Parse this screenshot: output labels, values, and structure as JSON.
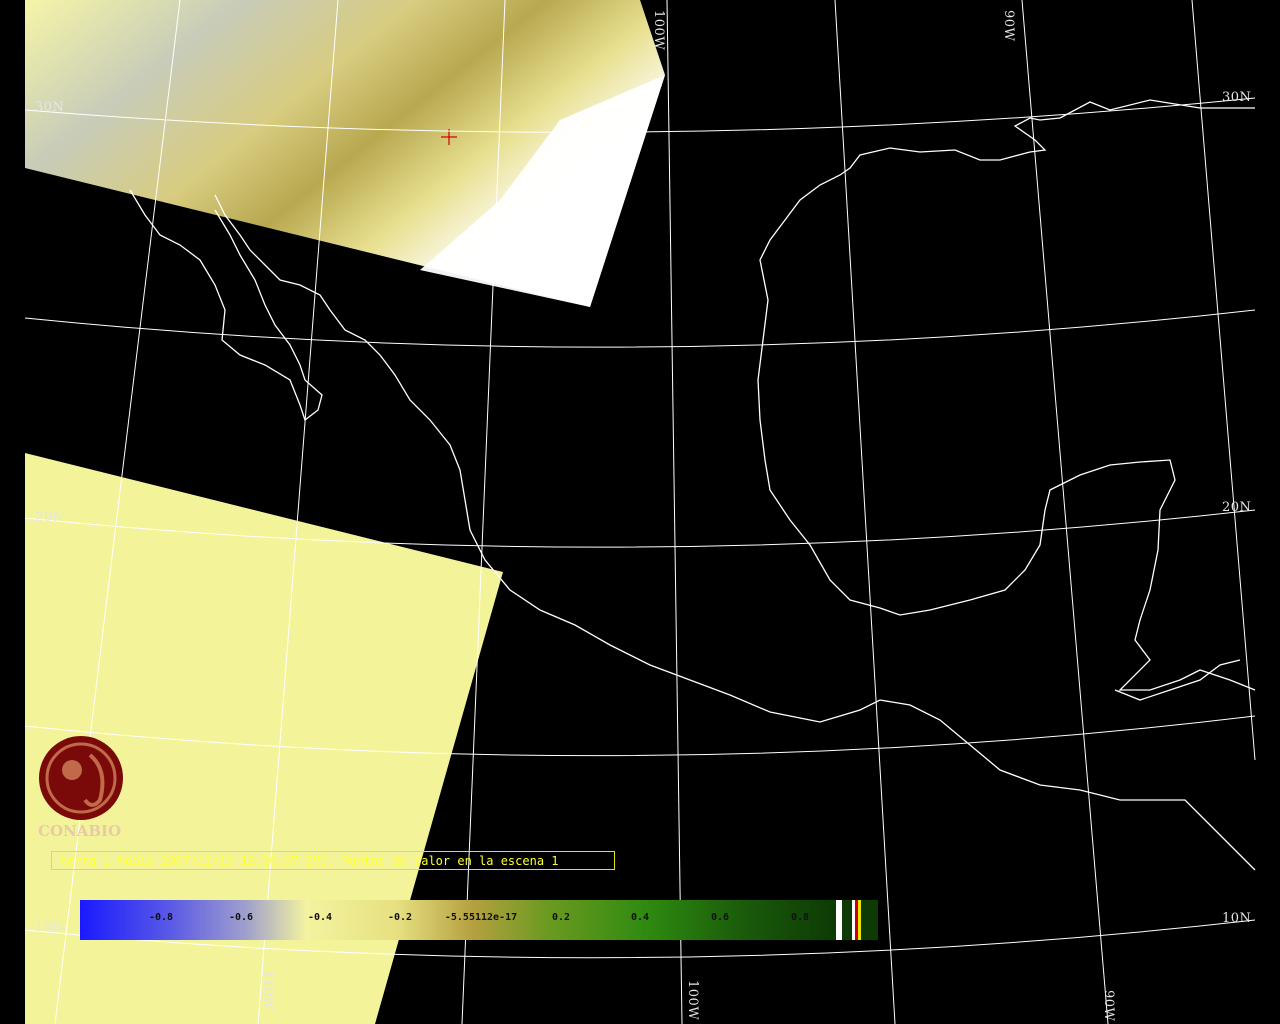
{
  "map": {
    "grid_labels": {
      "lon_100w_top": "100W",
      "lon_90w_top": "90W",
      "lat_30n_left": "30N",
      "lat_30n_right": "30N",
      "lat_20n_left": "20N",
      "lat_20n_right": "20N",
      "lat_10n_left": "10N",
      "lat_10n_right": "10N",
      "lon_100w_bottom": "100W",
      "lon_90w_bottom": "90W",
      "lon_110w_bottom": "110W"
    },
    "colors": {
      "background": "#000000",
      "grid": "#ffffff",
      "coastline": "#ffffff",
      "swath_pale": "#f3f39a",
      "hotspot_marker": "#cc0000"
    }
  },
  "logo": {
    "text": "CONABIO",
    "color": "#7a0a0a"
  },
  "caption": {
    "text": "terra-1 modis 2007/12/19 18:20:07 EVI. Puntos de calor en la escena 1"
  },
  "colorbar": {
    "labels": [
      "-0.8",
      "-0.6",
      "-0.4",
      "-0.2",
      "-5.55112e-17",
      "0.2",
      "0.4",
      "0.6",
      "0.8"
    ]
  }
}
